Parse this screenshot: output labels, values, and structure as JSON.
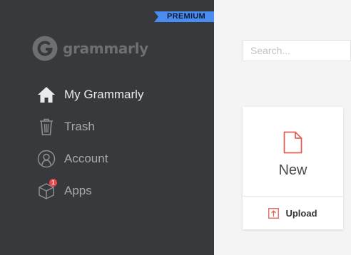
{
  "sidebar": {
    "premium_label": "PREMIUM",
    "brand_name": "grammarly",
    "items": [
      {
        "label": "My Grammarly",
        "icon": "home-icon",
        "active": true
      },
      {
        "label": "Trash",
        "icon": "trash-icon"
      },
      {
        "label": "Account",
        "icon": "account-icon"
      },
      {
        "label": "Apps",
        "icon": "cube-icon",
        "badge": "1"
      }
    ]
  },
  "search": {
    "placeholder": "Search..."
  },
  "card": {
    "new_label": "New",
    "upload_label": "Upload"
  },
  "colors": {
    "sidebar_bg": "#38393c",
    "premium_bg": "#4a8cf0",
    "accent_red": "#e0605a",
    "badge_red": "#e8484c",
    "page_bg": "#f4f4f4"
  }
}
